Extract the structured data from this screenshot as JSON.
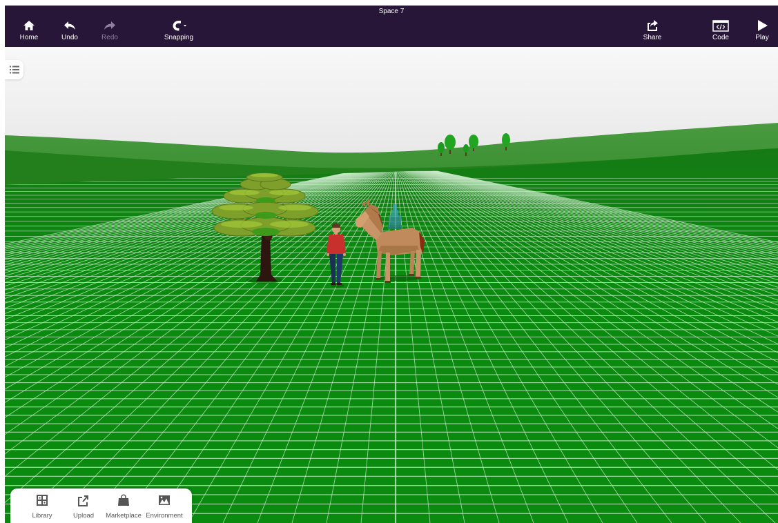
{
  "window": {
    "title": "Space 7"
  },
  "toolbar": {
    "home_label": "Home",
    "undo_label": "Undo",
    "redo_label": "Redo",
    "snapping_label": "Snapping",
    "share_label": "Share",
    "code_label": "Code",
    "play_label": "Play"
  },
  "icons": {
    "home": "home-icon",
    "undo": "undo-arrow-icon",
    "redo": "redo-arrow-icon",
    "snapping": "magnet-icon",
    "share": "share-icon",
    "code": "code-icon",
    "play": "play-icon",
    "outline": "list-icon",
    "library": "library-grid-icon",
    "upload": "upload-icon",
    "marketplace": "shopping-bag-icon",
    "environment": "landscape-image-icon"
  },
  "bottom_bar": {
    "library_label": "Library",
    "upload_label": "Upload",
    "marketplace_label": "Marketplace",
    "environment_label": "Environment"
  },
  "scene": {
    "objects": [
      "tree",
      "person",
      "horse",
      "distant-trees"
    ]
  },
  "colors": {
    "toolbar_bg": "#281638",
    "ground": "#0c8a12",
    "grid": "#c9e8c9",
    "sky": "#f2f2f2"
  }
}
